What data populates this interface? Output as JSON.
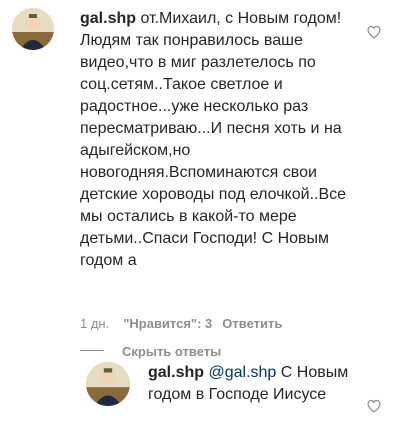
{
  "comment": {
    "username": "gal.shp",
    "text": "от.Михаил, с Новым годом!Людям так понравилось ваше видео,что в миг разлетелось по соц.сетям..Такое светлое и радостное...уже несколько раз пересматриваю...И песня хоть и на адыгейском,но новогодняя.Вспоминаются свои детские хороводы под елочкой..Все мы остались в какой-то мере детьми..Спаси Господи! С Новым годом а",
    "age": "1 дн.",
    "likes": "\"Нравится\": 3",
    "reply_label": "Ответить",
    "hide_replies_label": "Скрыть ответы"
  },
  "reply": {
    "username": "gal.shp",
    "mention": "@gal.shp",
    "text": "С Новым годом в Господе Иисусе"
  },
  "icons": {
    "like": "heart-outline-icon"
  },
  "colors": {
    "text": "#262626",
    "muted": "#8e8e8e",
    "mention": "#00376b"
  }
}
